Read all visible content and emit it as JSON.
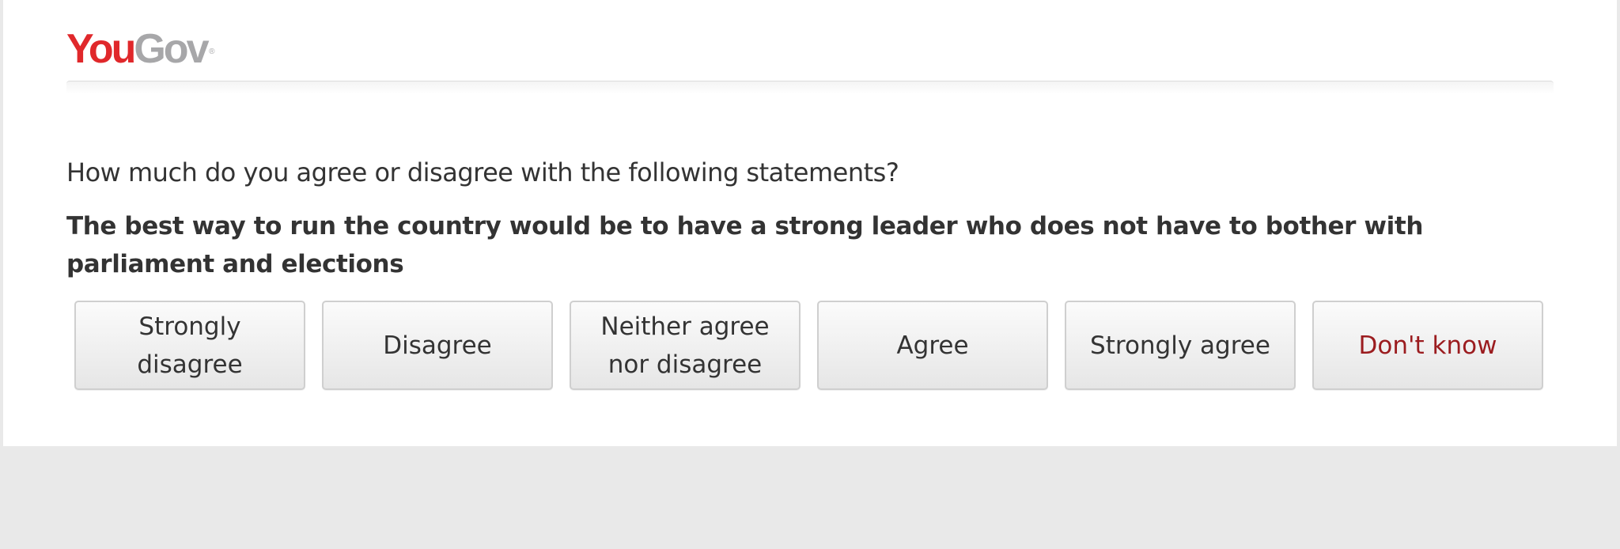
{
  "logo": {
    "part1": "You",
    "part2": "Gov",
    "mark": "®"
  },
  "question": "How much do you agree or disagree with the following statements?",
  "statement": "The best way to run the country would be to have a strong leader who does not have to bother with parliament and elections",
  "options": [
    {
      "label": "Strongly disagree"
    },
    {
      "label": "Disagree"
    },
    {
      "label": "Neither agree nor disagree"
    },
    {
      "label": "Agree"
    },
    {
      "label": "Strongly agree"
    },
    {
      "label": "Don't know"
    }
  ],
  "colors": {
    "brand_red": "#e0282b",
    "brand_grey": "#a7a7a9",
    "dont_know": "#9b1c1f",
    "page_bg": "#e9e9e9"
  }
}
